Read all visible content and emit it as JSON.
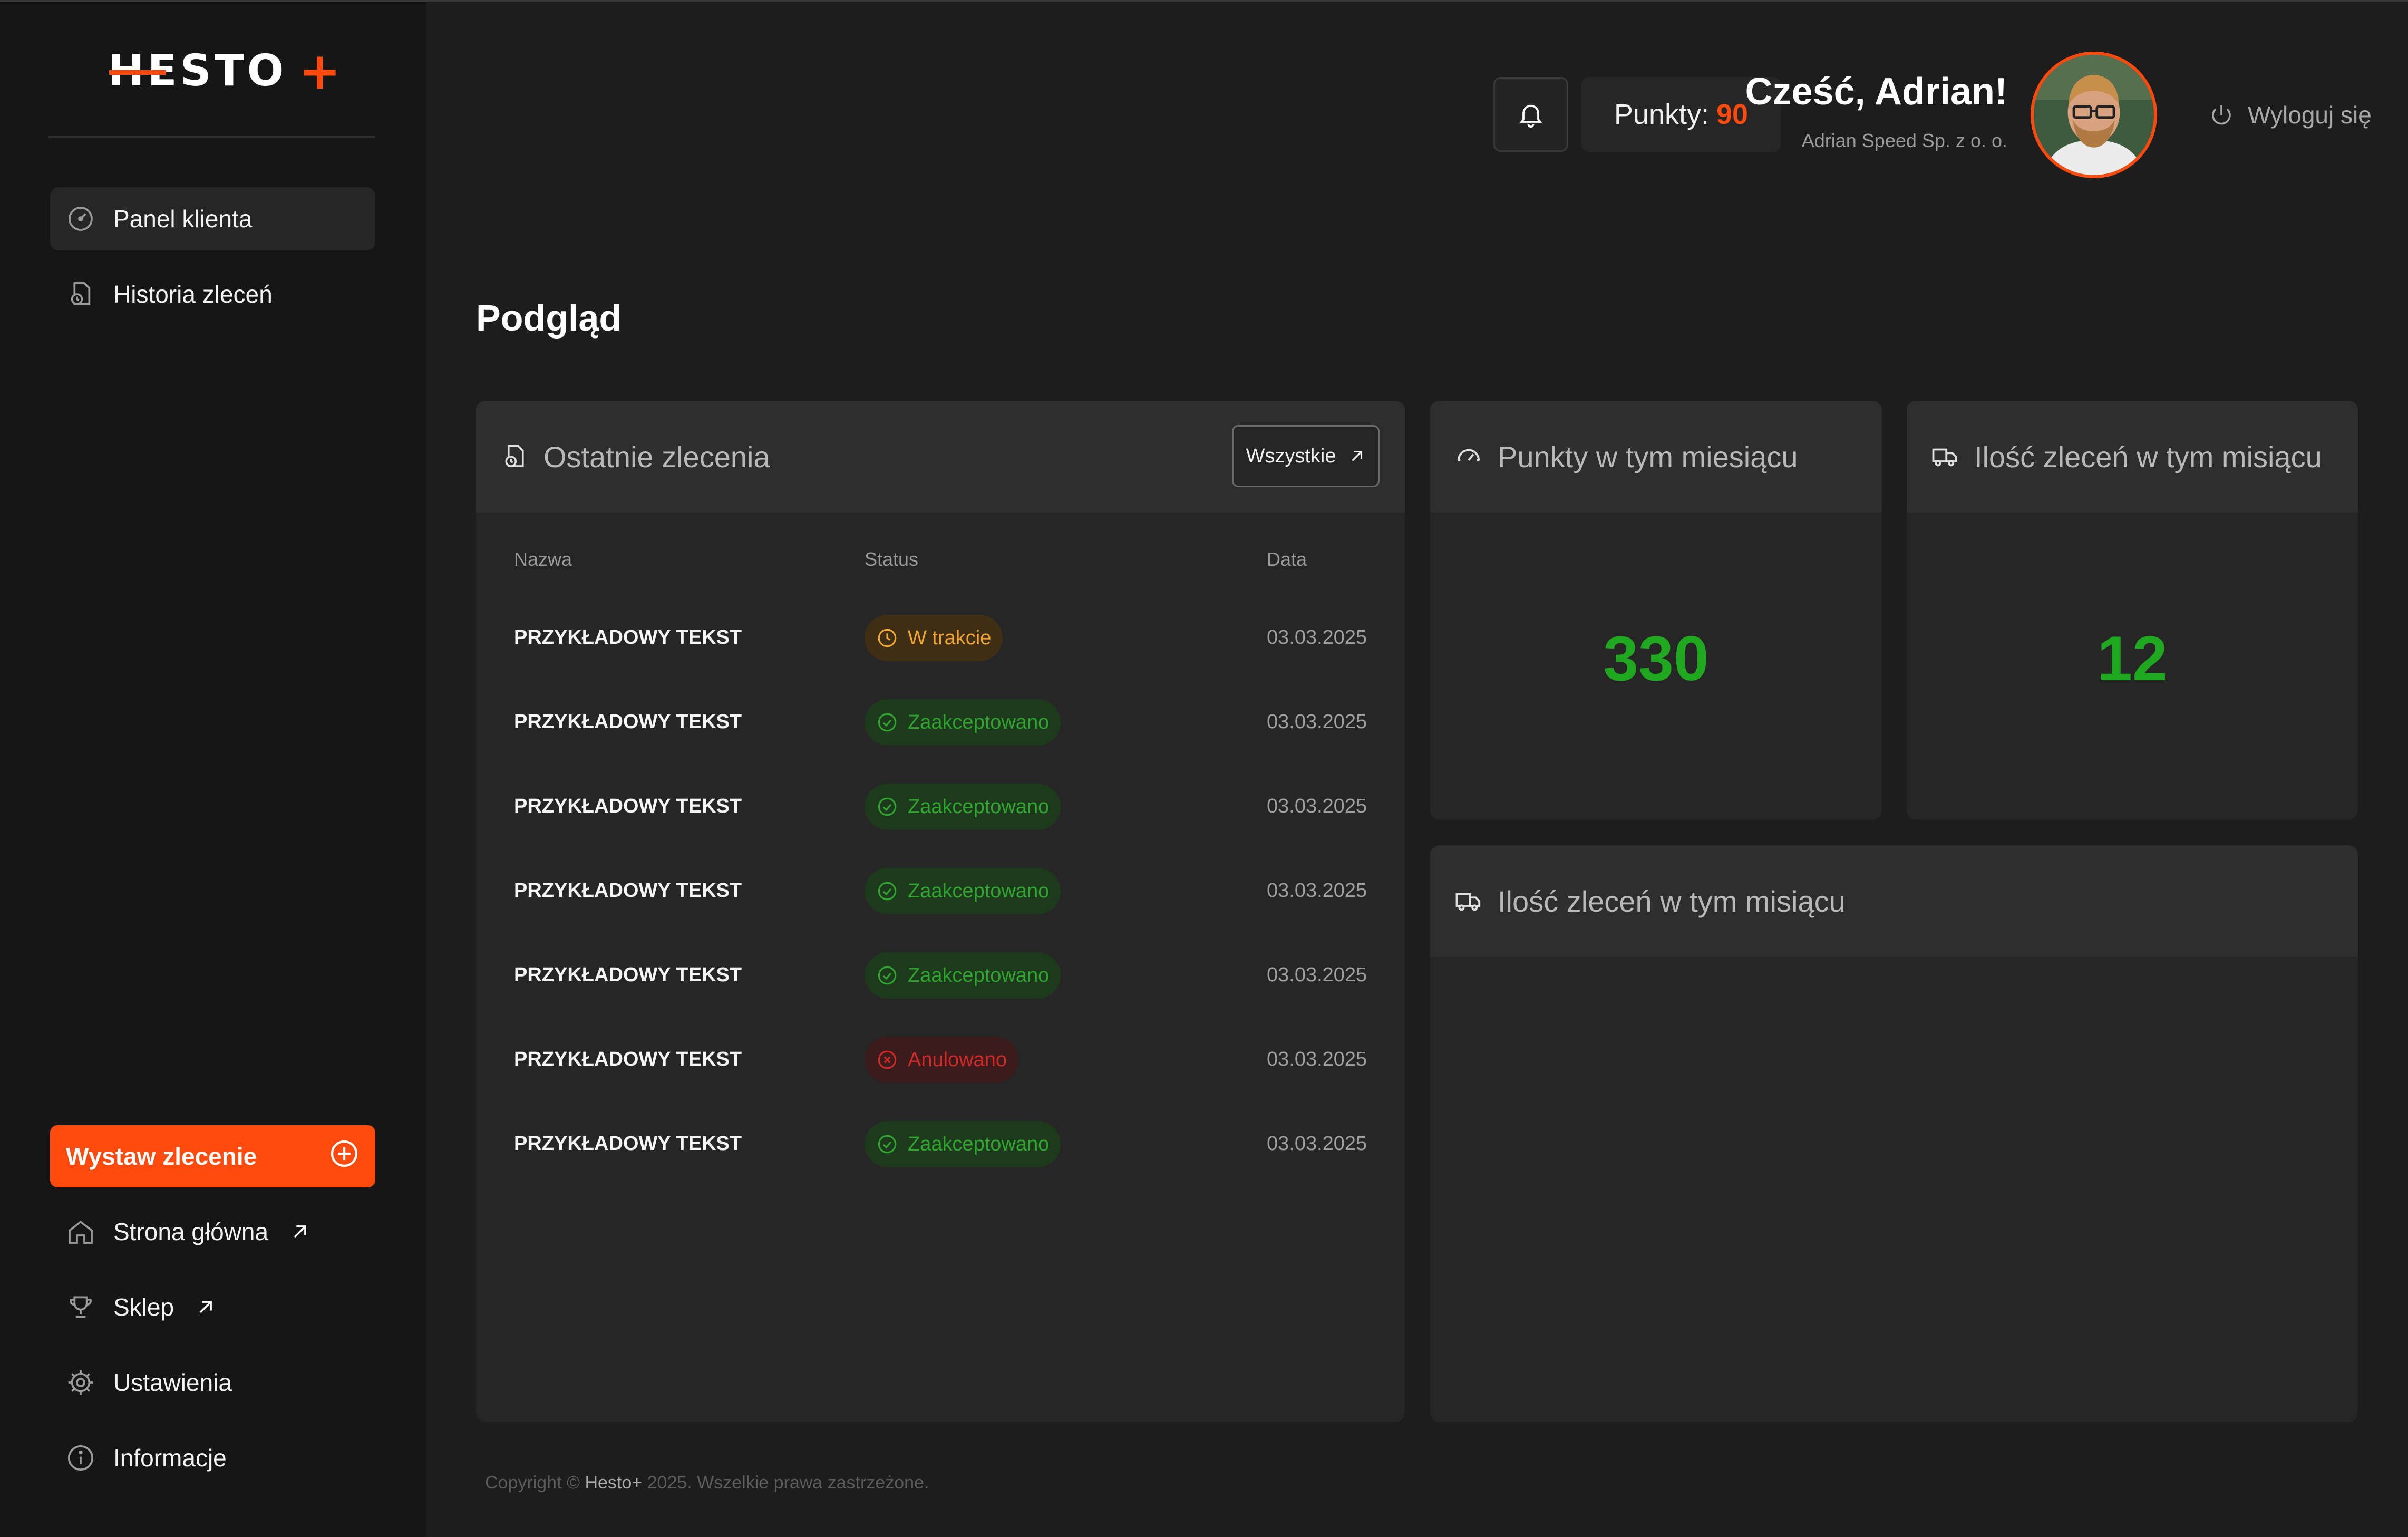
{
  "brand": {
    "logo_text": "HESTO",
    "logo_plus": "+",
    "accent": "#ff4a0e"
  },
  "sidebar": {
    "items": [
      {
        "label": "Panel klienta",
        "icon": "dashboard-gauge-icon",
        "active": true
      },
      {
        "label": "Historia zleceń",
        "icon": "order-history-icon",
        "active": false
      }
    ],
    "cta": {
      "label": "Wystaw zlecenie",
      "icon": "plus-circle-icon"
    },
    "bottom_items": [
      {
        "label": "Strona główna",
        "icon": "home-icon",
        "external": true
      },
      {
        "label": "Sklep",
        "icon": "trophy-icon",
        "external": true
      },
      {
        "label": "Ustawienia",
        "icon": "gear-icon",
        "external": false
      },
      {
        "label": "Informacje",
        "icon": "info-icon",
        "external": false
      }
    ]
  },
  "header": {
    "points_label": "Punkty:",
    "points_value": "90",
    "greeting": "Cześć, Adrian!",
    "company": "Adrian Speed Sp. z o. o.",
    "logout_label": "Wyloguj się"
  },
  "page": {
    "title": "Podgląd"
  },
  "orders_card": {
    "title": "Ostatnie zlecenia",
    "all_button": "Wszystkie",
    "columns": {
      "name": "Nazwa",
      "status": "Status",
      "date": "Data"
    },
    "rows": [
      {
        "name": "PRZYKŁADOWY TEKST",
        "status": "W trakcie",
        "status_type": "pending",
        "date": "03.03.2025"
      },
      {
        "name": "PRZYKŁADOWY TEKST",
        "status": "Zaakceptowano",
        "status_type": "ok",
        "date": "03.03.2025"
      },
      {
        "name": "PRZYKŁADOWY TEKST",
        "status": "Zaakceptowano",
        "status_type": "ok",
        "date": "03.03.2025"
      },
      {
        "name": "PRZYKŁADOWY TEKST",
        "status": "Zaakceptowano",
        "status_type": "ok",
        "date": "03.03.2025"
      },
      {
        "name": "PRZYKŁADOWY TEKST",
        "status": "Zaakceptowano",
        "status_type": "ok",
        "date": "03.03.2025"
      },
      {
        "name": "PRZYKŁADOWY TEKST",
        "status": "Anulowano",
        "status_type": "cancel",
        "date": "03.03.2025"
      },
      {
        "name": "PRZYKŁADOWY TEKST",
        "status": "Zaakceptowano",
        "status_type": "ok",
        "date": "03.03.2025"
      }
    ]
  },
  "points_card": {
    "title": "Punkty w tym miesiącu",
    "value": "330"
  },
  "count_card": {
    "title": "Ilość zleceń w tym misiącu",
    "value": "12"
  },
  "chart_card": {
    "title": "Ilość zleceń w tym misiącu"
  },
  "footer": {
    "prefix": "Copyright ©",
    "brand": "Hesto+",
    "suffix": "2025. Wszelkie prawa zastrzeżone."
  },
  "colors": {
    "pending": "#f2a531",
    "ok": "#2fa52f",
    "cancel": "#d32828",
    "big_number": "#1fa81f"
  }
}
